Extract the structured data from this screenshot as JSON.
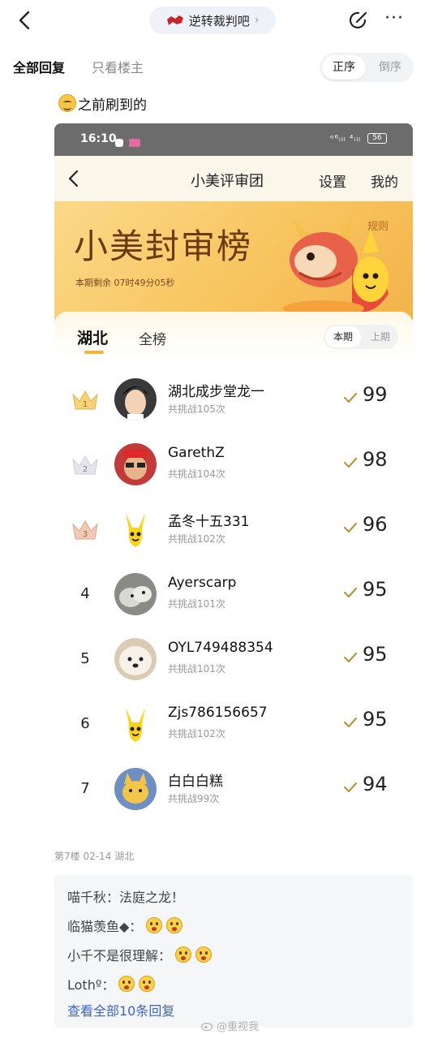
{
  "topbar": {
    "forum_name": "逆转裁判吧",
    "forum_chevron": "›",
    "more_label": "···"
  },
  "tabs": {
    "all": "全部回复",
    "host_only": "只看楼主",
    "order_asc": "正序",
    "order_desc": "倒序"
  },
  "post": {
    "text": "之前刷到的"
  },
  "screenshot": {
    "status_time": "16:10",
    "status_right": "ᵒ⁶ᵢₗₗ ⁴ᵢₗₗ",
    "battery": "56",
    "app_title": "小美评审团",
    "settings": "设置",
    "mine": "我的",
    "banner_title": "小美封审榜",
    "banner_sub": "本期剩余 07时49分05秒",
    "rules": "规则",
    "region_tab": "湖北",
    "all_tab": "全榜",
    "period_current": "本期",
    "period_prev": "上期",
    "rows": [
      {
        "rank": "1",
        "name": "湖北成步堂龙一",
        "count": "共挑战105次",
        "score": "99"
      },
      {
        "rank": "2",
        "name": "GarethZ",
        "count": "共挑战104次",
        "score": "98"
      },
      {
        "rank": "3",
        "name": "孟冬十五331",
        "count": "共挑战102次",
        "score": "96"
      },
      {
        "rank": "4",
        "name": "Ayerscarp",
        "count": "共挑战101次",
        "score": "95"
      },
      {
        "rank": "5",
        "name": "OYL749488354",
        "count": "共挑战101次",
        "score": "95"
      },
      {
        "rank": "6",
        "name": "Zjs786156657",
        "count": "共挑战102次",
        "score": "95"
      },
      {
        "rank": "7",
        "name": "白白白糕",
        "count": "共挑战99次",
        "score": "94"
      }
    ]
  },
  "meta": {
    "text": "第7楼  02-14  湖北"
  },
  "replies": {
    "items": [
      {
        "name": "喵千秋：",
        "text": "法庭之龙！",
        "faces": 0
      },
      {
        "name": "临猫羡鱼◆：",
        "text": "",
        "faces": 2
      },
      {
        "name": "小千不是很理解：",
        "text": "",
        "faces": 2
      },
      {
        "name": "Lothº：",
        "text": "",
        "faces": 2
      }
    ],
    "view_all": "查看全部10条回复"
  },
  "watermark": "@重视我"
}
